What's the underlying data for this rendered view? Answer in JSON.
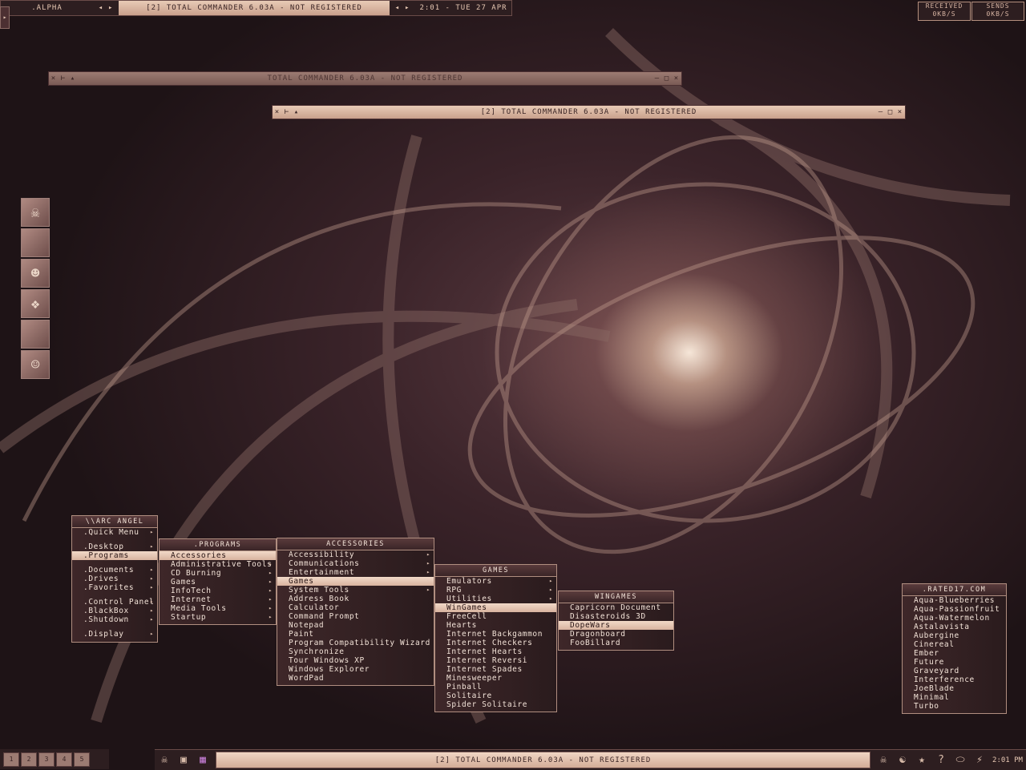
{
  "topbar": {
    "workspace": ".ALPHA",
    "window_title": "[2] TOTAL COMMANDER 6.03A - NOT REGISTERED",
    "clock": "2:01 - TUE 27 APR"
  },
  "netmon": {
    "received_label": "RECEIVED",
    "received_value": "0KB/S",
    "sends_label": "SENDS",
    "sends_value": "0KB/S"
  },
  "windows": {
    "win1_title": "TOTAL COMMANDER 6.03A - NOT REGISTERED",
    "win2_title": "[2] TOTAL COMMANDER 6.03A - NOT REGISTERED"
  },
  "root_menu": {
    "title": "\\\\ARC ANGEL",
    "groups": [
      [
        ".Quick Menu"
      ],
      [
        ".Desktop",
        ".Programs"
      ],
      [
        ".Documents",
        ".Drives",
        ".Favorites"
      ],
      [
        ".Control Panel",
        ".BlackBox",
        ".Shutdown"
      ],
      [
        ".Display"
      ]
    ]
  },
  "programs_menu": {
    "title": ".PROGRAMS",
    "items": [
      "Accessories",
      "Administrative Tools",
      "CD Burning",
      "Games",
      "InfoTech",
      "Internet",
      "Media Tools",
      "Startup"
    ]
  },
  "accessories_menu": {
    "title": "ACCESSORIES",
    "items": [
      "Accessibility",
      "Communications",
      "Entertainment",
      "Games",
      "System Tools",
      "Address Book",
      "Calculator",
      "Command Prompt",
      "Notepad",
      "Paint",
      "Program Compatibility Wizard",
      "Synchronize",
      "Tour Windows XP",
      "Windows Explorer",
      "WordPad"
    ]
  },
  "games_menu": {
    "title": "GAMES",
    "items": [
      "Emulators",
      "RPG",
      "Utilities",
      "WinGames",
      "FreeCell",
      "Hearts",
      "Internet Backgammon",
      "Internet Checkers",
      "Internet Hearts",
      "Internet Reversi",
      "Internet Spades",
      "Minesweeper",
      "Pinball",
      "Solitaire",
      "Spider Solitaire"
    ]
  },
  "wingames_menu": {
    "title": "WINGAMES",
    "items": [
      "Capricorn Document",
      "Disasteroids 3D",
      "DopeWars",
      "Dragonboard",
      "FooBillard"
    ]
  },
  "styles_menu": {
    "title": ".RATED17.COM",
    "items": [
      "Aqua-Blueberries",
      "Aqua-Passionfruit",
      "Aqua-Watermelon",
      "Astalavista",
      "Aubergine",
      "Cinereal",
      "Ember",
      "Future",
      "Graveyard",
      "Interference",
      "JoeBlade",
      "Minimal",
      "Turbo"
    ]
  },
  "taskbar": {
    "window_label": "[2] TOTAL COMMANDER 6.03A - NOT REGISTERED",
    "clock": "2:01 PM",
    "workspaces": [
      "1",
      "2",
      "3",
      "4",
      "5"
    ]
  },
  "colors": {
    "accent": "#e8cbb6",
    "background_dark": "#2d1e20",
    "menu_border": "#b08e80"
  }
}
